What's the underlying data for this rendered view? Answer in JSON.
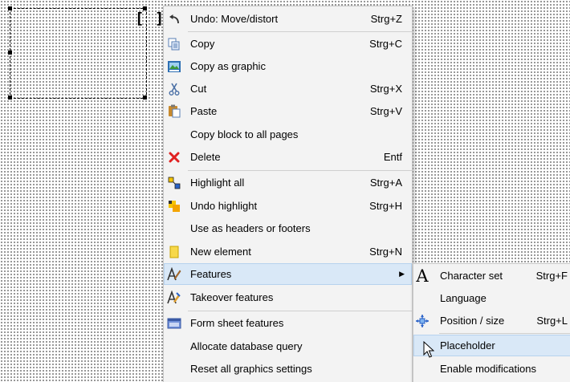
{
  "menu": {
    "items": [
      {
        "label": "Undo: Move/distort",
        "shortcut": "Strg+Z",
        "icon": "undo-icon"
      },
      {
        "label": "Copy",
        "shortcut": "Strg+C",
        "icon": "copy-icon"
      },
      {
        "label": "Copy as graphic",
        "shortcut": "",
        "icon": "copy-graphic-icon"
      },
      {
        "label": "Cut",
        "shortcut": "Strg+X",
        "icon": "cut-icon"
      },
      {
        "label": "Paste",
        "shortcut": "Strg+V",
        "icon": "paste-icon"
      },
      {
        "label": "Copy block to all pages",
        "shortcut": ""
      },
      {
        "label": "Delete",
        "shortcut": "Entf",
        "icon": "delete-icon"
      },
      {
        "label": "Highlight all",
        "shortcut": "Strg+A",
        "icon": "highlight-all-icon"
      },
      {
        "label": "Undo highlight",
        "shortcut": "Strg+H",
        "icon": "undo-highlight-icon"
      },
      {
        "label": "Use as headers or footers",
        "shortcut": ""
      },
      {
        "label": "New element",
        "shortcut": "Strg+N",
        "icon": "new-element-icon"
      },
      {
        "label": "Features",
        "shortcut": "",
        "icon": "features-icon",
        "arrow": "▶"
      },
      {
        "label": "Takeover features",
        "shortcut": "",
        "icon": "takeover-features-icon"
      },
      {
        "label": "Form sheet features",
        "shortcut": "",
        "icon": "form-sheet-icon"
      },
      {
        "label": "Allocate database query",
        "shortcut": ""
      },
      {
        "label": "Reset all graphics settings",
        "shortcut": ""
      }
    ]
  },
  "submenu": {
    "items": [
      {
        "label": "Character set",
        "shortcut": "Strg+F",
        "icon": "character-set-icon",
        "glyph": "A"
      },
      {
        "label": "Language",
        "shortcut": ""
      },
      {
        "label": "Position / size",
        "shortcut": "Strg+L",
        "icon": "position-size-icon"
      },
      {
        "label": "Placeholder",
        "shortcut": ""
      },
      {
        "label": "Enable modifications",
        "shortcut": ""
      }
    ]
  },
  "canvas": {
    "block_marker": "[ ]"
  },
  "colors": {
    "highlight": "#d9e8f7",
    "menu_bg": "#f3f3f3",
    "delete_red": "#e02020"
  }
}
